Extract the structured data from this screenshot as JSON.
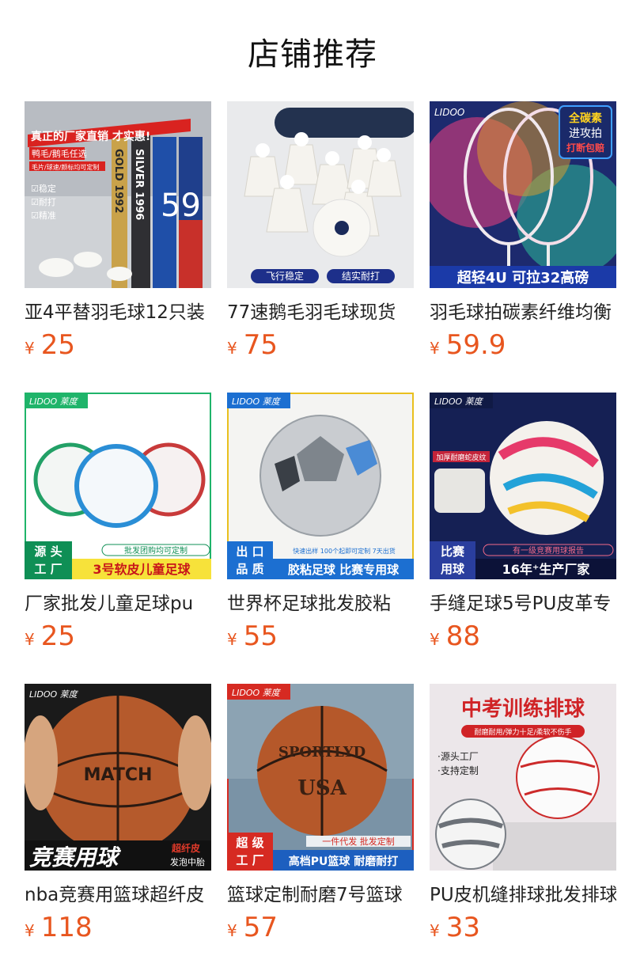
{
  "page": {
    "title": "店铺推荐"
  },
  "products": [
    {
      "name": "亚4平替羽毛球12只装",
      "currency": "¥",
      "price": "25",
      "image": {
        "headline": "真正的厂家直销 才实惠!",
        "sub1": "鸭毛/鹅毛任选",
        "sub2": "毛片/球速/颜标均可定制",
        "check1": "☑稳定",
        "check2": "☑耐打",
        "check3": "☑精准",
        "tube1": "GOLD 1992",
        "tube2": "SILVER 1996",
        "tube3": "59"
      }
    },
    {
      "name": "77速鹅毛羽毛球现货",
      "currency": "¥",
      "price": "75",
      "image": {
        "tag1": "飞行稳定",
        "tag2": "结实耐打"
      }
    },
    {
      "name": "羽毛球拍碳素纤维均衡",
      "currency": "¥",
      "price": "59.9",
      "image": {
        "brand": "LIDOO",
        "badge1": "全碳素",
        "badge2": "进攻拍",
        "badge3": "打断包赔",
        "bottom": "超轻4U 可拉32高磅"
      }
    },
    {
      "name": "厂家批发儿童足球pu",
      "currency": "¥",
      "price": "25",
      "image": {
        "brand": "LIDOO 莱度",
        "tagA": "源 头",
        "tagB": "工 厂",
        "top": "批发团购均可定制",
        "bottom": "3号软皮儿童足球"
      }
    },
    {
      "name": "世界杯足球批发胶粘",
      "currency": "¥",
      "price": "55",
      "image": {
        "brand": "LIDOO 莱度",
        "tagA": "出 口",
        "tagB": "品 质",
        "top": "快速出样 100个起即可定制 7天出货",
        "bottom": "胶粘足球 比赛专用球"
      }
    },
    {
      "name": "手缝足球5号PU皮革专",
      "currency": "¥",
      "price": "88",
      "image": {
        "brand": "LIDOO 莱度",
        "note": "加厚耐磨蛇皮纹",
        "tagA": "比赛",
        "tagB": "用球",
        "top": "有一级竞赛用球报告",
        "bottom": "16年⁺生产厂家"
      }
    },
    {
      "name": "nba竞赛用篮球超纤皮",
      "currency": "¥",
      "price": "118",
      "image": {
        "brand": "LIDOO 莱度",
        "ball": "MATCH",
        "big": "竞赛用球",
        "side1": "超纤皮",
        "side2": "发泡中胎"
      }
    },
    {
      "name": "篮球定制耐磨7号篮球",
      "currency": "¥",
      "price": "57",
      "image": {
        "brand": "LIDOO 莱度",
        "ball1": "SPORTLYD",
        "ball2": "USA",
        "tagA": "超 级",
        "tagB": "工 厂",
        "top": "一件代发 批发定制",
        "bottom": "高档PU篮球 耐磨耐打"
      }
    },
    {
      "name": "PU皮机缝排球批发排球",
      "currency": "¥",
      "price": "33",
      "image": {
        "headline": "中考训练排球",
        "sub": "耐磨耐用/弹力十足/柔软不伤手",
        "l1": "·源头工厂",
        "l2": "·支持定制"
      }
    }
  ]
}
